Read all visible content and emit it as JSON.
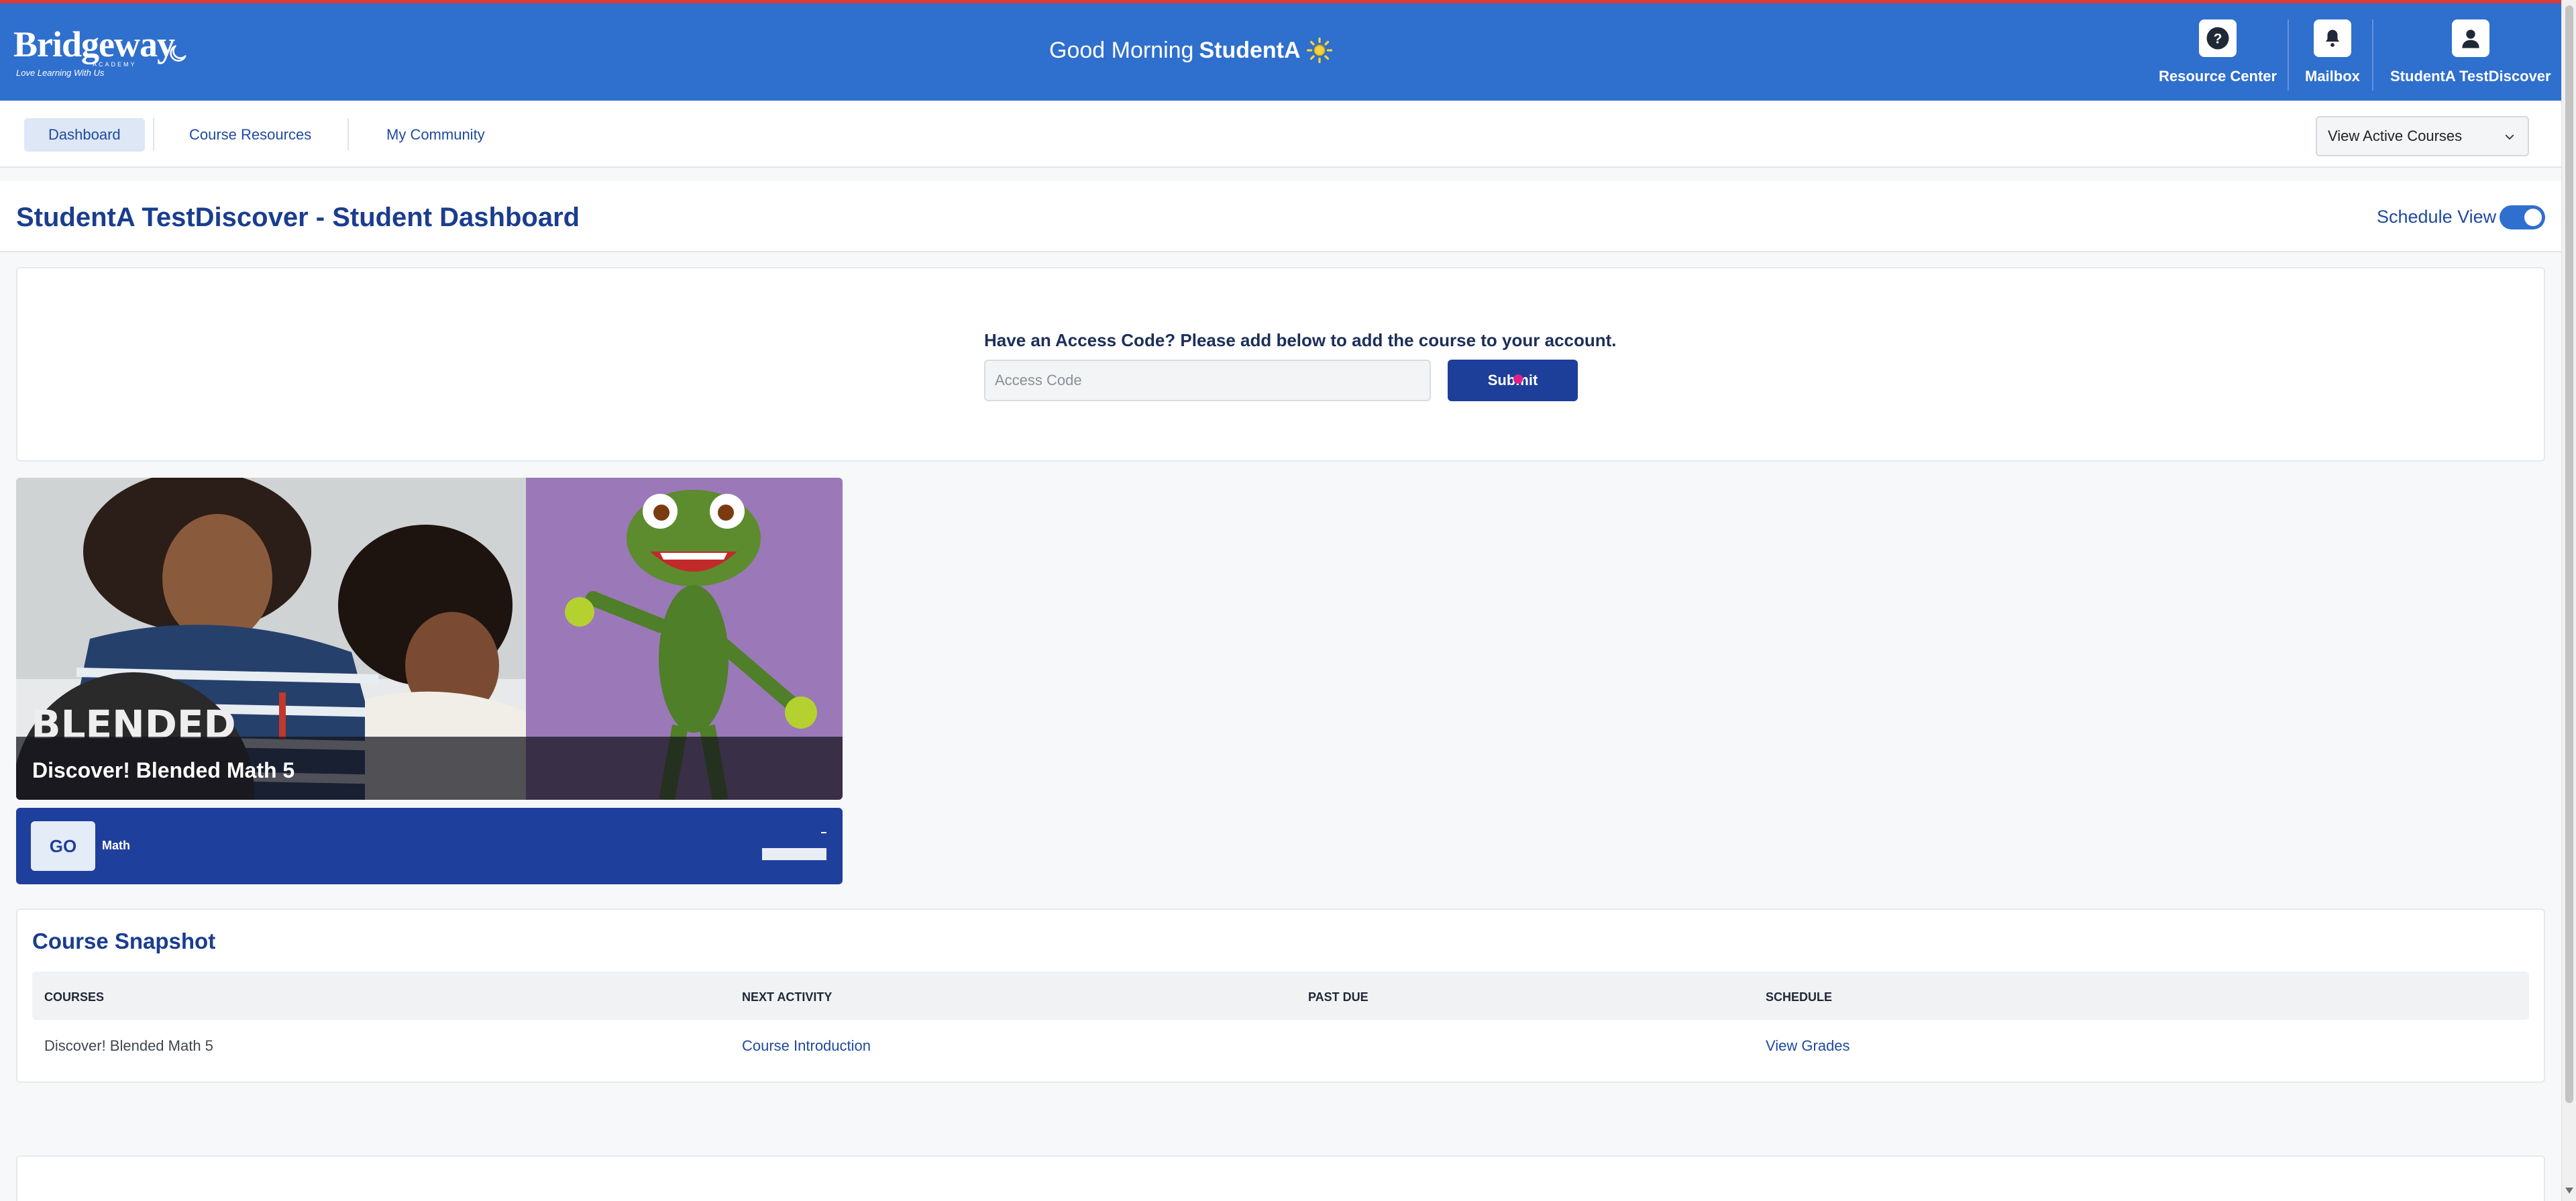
{
  "header": {
    "logo_text": "Bridgeway",
    "logo_sub": "ACADEMY",
    "logo_tagline": "Love Learning With Us",
    "greeting_prefix": "Good Morning",
    "greeting_name": "StudentA",
    "resource_center": "Resource Center",
    "mailbox": "Mailbox",
    "profile": "StudentA TestDiscover",
    "colors": {
      "bar": "#2f6fce",
      "top_stripe": "#d93a3a"
    }
  },
  "nav": {
    "tabs": [
      "Dashboard",
      "Course Resources",
      "My Community"
    ],
    "active_tab": "Dashboard",
    "course_filter": "View Active Courses"
  },
  "page": {
    "title": "StudentA TestDiscover - Student Dashboard",
    "schedule_view_label": "Schedule View",
    "schedule_view_on": true
  },
  "access": {
    "prompt": "Have an Access Code? Please add below to add the course to your account.",
    "placeholder": "Access Code",
    "value": "",
    "submit_label": "Submit"
  },
  "course_tile": {
    "name": "Discover! Blended Math 5",
    "go_label": "GO",
    "subject": "Math",
    "badge_text": "BLENDED",
    "accent": "#1f3f9c"
  },
  "snapshot": {
    "title": "Course Snapshot",
    "columns": [
      "COURSES",
      "NEXT ACTIVITY",
      "PAST DUE",
      "SCHEDULE"
    ],
    "rows": [
      {
        "course": "Discover! Blended Math 5",
        "next_activity": "Course Introduction",
        "past_due": "",
        "schedule": "View Grades"
      }
    ]
  },
  "icons": {
    "theme": "moon-icon",
    "greeting": "sun-icon",
    "resource_center": "question-icon",
    "mailbox": "bell-icon",
    "profile": "user-icon",
    "filter": "chevron-down-icon"
  }
}
